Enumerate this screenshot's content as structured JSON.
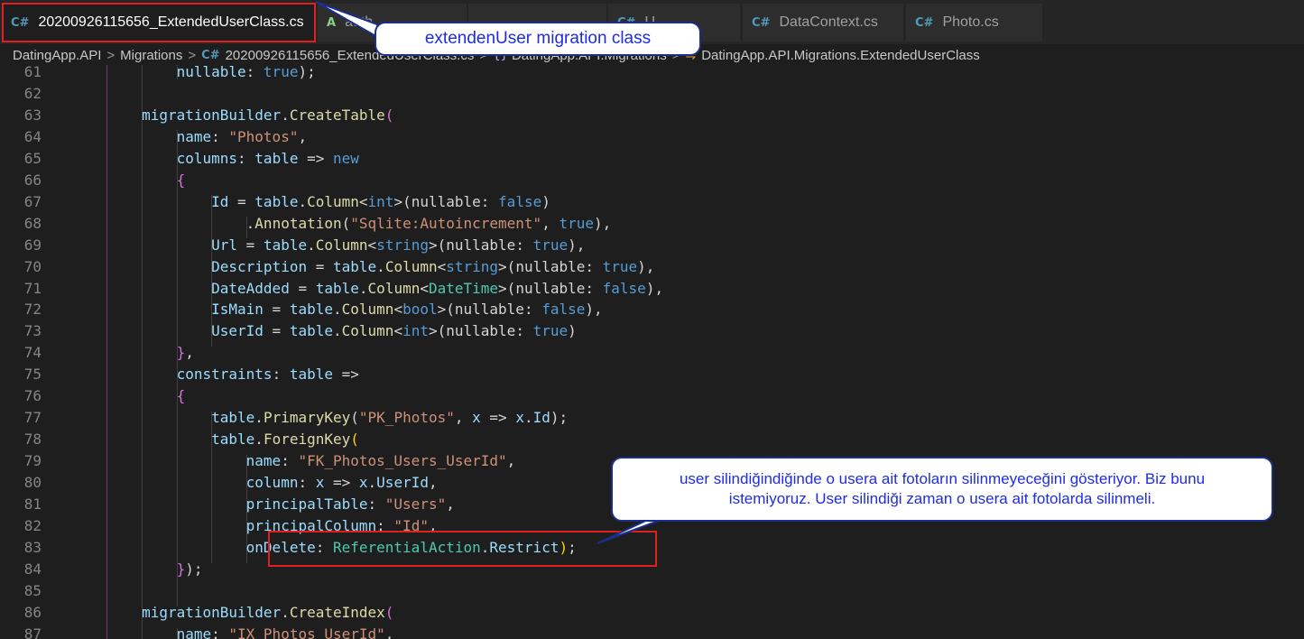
{
  "tabs": [
    {
      "icon": "C#",
      "label": "20200926115656_ExtendedUserClass.cs",
      "active": true,
      "close": "✕"
    },
    {
      "icon": "A",
      "label": "auth"
    },
    {
      "icon": "",
      "label": ""
    },
    {
      "icon": "C#",
      "label": "U"
    },
    {
      "icon": "C#",
      "label": "DataContext.cs"
    },
    {
      "icon": "C#",
      "label": "Photo.cs"
    }
  ],
  "breadcrumb": {
    "items": [
      "DatingApp.API",
      "Migrations",
      "20200926115656_ExtendedUserClass.cs",
      "DatingApp.API.Migrations",
      "DatingApp.API.Migrations.ExtendedUserClass"
    ],
    "separator": ">",
    "cs_icon": "C#",
    "ns_icon": "{}",
    "class_icon": "⇋"
  },
  "code_lines": [
    {
      "num": "61",
      "tokens": [
        [
          "i",
          "            "
        ],
        [
          "var",
          "nullable"
        ],
        [
          "p",
          ": "
        ],
        [
          "kw",
          "true"
        ],
        [
          "p",
          ");"
        ]
      ]
    },
    {
      "num": "62",
      "tokens": []
    },
    {
      "num": "63",
      "tokens": [
        [
          "i",
          "        "
        ],
        [
          "var",
          "migrationBuilder"
        ],
        [
          "p",
          "."
        ],
        [
          "fn",
          "CreateTable"
        ],
        [
          "br",
          "("
        ]
      ]
    },
    {
      "num": "64",
      "tokens": [
        [
          "i",
          "            "
        ],
        [
          "var",
          "name"
        ],
        [
          "p",
          ": "
        ],
        [
          "str",
          "\"Photos\""
        ],
        [
          "p",
          ","
        ]
      ]
    },
    {
      "num": "65",
      "tokens": [
        [
          "i",
          "            "
        ],
        [
          "var",
          "columns"
        ],
        [
          "p",
          ": "
        ],
        [
          "var",
          "table"
        ],
        [
          "p",
          " => "
        ],
        [
          "kw",
          "new"
        ]
      ]
    },
    {
      "num": "66",
      "tokens": [
        [
          "i",
          "            "
        ],
        [
          "br",
          "{"
        ]
      ]
    },
    {
      "num": "67",
      "tokens": [
        [
          "i",
          "                "
        ],
        [
          "var",
          "Id"
        ],
        [
          "p",
          " = "
        ],
        [
          "var",
          "table"
        ],
        [
          "p",
          "."
        ],
        [
          "fn",
          "Column"
        ],
        [
          "p",
          "<"
        ],
        [
          "kw",
          "int"
        ],
        [
          "p",
          ">(nullable: "
        ],
        [
          "kw",
          "false"
        ],
        [
          "p",
          ")"
        ]
      ]
    },
    {
      "num": "68",
      "tokens": [
        [
          "i",
          "                    "
        ],
        [
          "p",
          "."
        ],
        [
          "fn",
          "Annotation"
        ],
        [
          "p",
          "("
        ],
        [
          "str",
          "\"Sqlite:Autoincrement\""
        ],
        [
          "p",
          ", "
        ],
        [
          "kw",
          "true"
        ],
        [
          "p",
          "),"
        ]
      ]
    },
    {
      "num": "69",
      "tokens": [
        [
          "i",
          "                "
        ],
        [
          "var",
          "Url"
        ],
        [
          "p",
          " = "
        ],
        [
          "var",
          "table"
        ],
        [
          "p",
          "."
        ],
        [
          "fn",
          "Column"
        ],
        [
          "p",
          "<"
        ],
        [
          "kw",
          "string"
        ],
        [
          "p",
          ">(nullable: "
        ],
        [
          "kw",
          "true"
        ],
        [
          "p",
          "),"
        ]
      ]
    },
    {
      "num": "70",
      "tokens": [
        [
          "i",
          "                "
        ],
        [
          "var",
          "Description"
        ],
        [
          "p",
          " = "
        ],
        [
          "var",
          "table"
        ],
        [
          "p",
          "."
        ],
        [
          "fn",
          "Column"
        ],
        [
          "p",
          "<"
        ],
        [
          "kw",
          "string"
        ],
        [
          "p",
          ">(nullable: "
        ],
        [
          "kw",
          "true"
        ],
        [
          "p",
          "),"
        ]
      ]
    },
    {
      "num": "71",
      "tokens": [
        [
          "i",
          "                "
        ],
        [
          "var",
          "DateAdded"
        ],
        [
          "p",
          " = "
        ],
        [
          "var",
          "table"
        ],
        [
          "p",
          "."
        ],
        [
          "fn",
          "Column"
        ],
        [
          "p",
          "<"
        ],
        [
          "ty",
          "DateTime"
        ],
        [
          "p",
          ">(nullable: "
        ],
        [
          "kw",
          "false"
        ],
        [
          "p",
          "),"
        ]
      ]
    },
    {
      "num": "72",
      "tokens": [
        [
          "i",
          "                "
        ],
        [
          "var",
          "IsMain"
        ],
        [
          "p",
          " = "
        ],
        [
          "var",
          "table"
        ],
        [
          "p",
          "."
        ],
        [
          "fn",
          "Column"
        ],
        [
          "p",
          "<"
        ],
        [
          "kw",
          "bool"
        ],
        [
          "p",
          ">(nullable: "
        ],
        [
          "kw",
          "false"
        ],
        [
          "p",
          "),"
        ]
      ]
    },
    {
      "num": "73",
      "tokens": [
        [
          "i",
          "                "
        ],
        [
          "var",
          "UserId"
        ],
        [
          "p",
          " = "
        ],
        [
          "var",
          "table"
        ],
        [
          "p",
          "."
        ],
        [
          "fn",
          "Column"
        ],
        [
          "p",
          "<"
        ],
        [
          "kw",
          "int"
        ],
        [
          "p",
          ">(nullable: "
        ],
        [
          "kw",
          "true"
        ],
        [
          "p",
          ")"
        ]
      ]
    },
    {
      "num": "74",
      "tokens": [
        [
          "i",
          "            "
        ],
        [
          "br",
          "}"
        ],
        [
          "p",
          ","
        ]
      ]
    },
    {
      "num": "75",
      "tokens": [
        [
          "i",
          "            "
        ],
        [
          "var",
          "constraints"
        ],
        [
          "p",
          ": "
        ],
        [
          "var",
          "table"
        ],
        [
          "p",
          " =>"
        ]
      ]
    },
    {
      "num": "76",
      "tokens": [
        [
          "i",
          "            "
        ],
        [
          "br",
          "{"
        ]
      ]
    },
    {
      "num": "77",
      "tokens": [
        [
          "i",
          "                "
        ],
        [
          "var",
          "table"
        ],
        [
          "p",
          "."
        ],
        [
          "fn",
          "PrimaryKey"
        ],
        [
          "p",
          "("
        ],
        [
          "str",
          "\"PK_Photos\""
        ],
        [
          "p",
          ", "
        ],
        [
          "var",
          "x"
        ],
        [
          "p",
          " => "
        ],
        [
          "var",
          "x"
        ],
        [
          "p",
          "."
        ],
        [
          "var",
          "Id"
        ],
        [
          "p",
          ");"
        ]
      ]
    },
    {
      "num": "78",
      "tokens": [
        [
          "i",
          "                "
        ],
        [
          "var",
          "table"
        ],
        [
          "p",
          "."
        ],
        [
          "fn",
          "ForeignKey"
        ],
        [
          "br2",
          "("
        ]
      ]
    },
    {
      "num": "79",
      "tokens": [
        [
          "i",
          "                    "
        ],
        [
          "var",
          "name"
        ],
        [
          "p",
          ": "
        ],
        [
          "str",
          "\"FK_Photos_Users_UserId\""
        ],
        [
          "p",
          ","
        ]
      ]
    },
    {
      "num": "80",
      "tokens": [
        [
          "i",
          "                    "
        ],
        [
          "var",
          "column"
        ],
        [
          "p",
          ": "
        ],
        [
          "var",
          "x"
        ],
        [
          "p",
          " => "
        ],
        [
          "var",
          "x"
        ],
        [
          "p",
          "."
        ],
        [
          "var",
          "UserId"
        ],
        [
          "p",
          ","
        ]
      ]
    },
    {
      "num": "81",
      "tokens": [
        [
          "i",
          "                    "
        ],
        [
          "var",
          "principalTable"
        ],
        [
          "p",
          ": "
        ],
        [
          "str",
          "\"Users\""
        ],
        [
          "p",
          ","
        ]
      ]
    },
    {
      "num": "82",
      "tokens": [
        [
          "i",
          "                    "
        ],
        [
          "var",
          "principalColumn"
        ],
        [
          "p",
          ": "
        ],
        [
          "str",
          "\"Id\""
        ],
        [
          "p",
          ","
        ]
      ]
    },
    {
      "num": "83",
      "tokens": [
        [
          "i",
          "                    "
        ],
        [
          "var",
          "onDelete"
        ],
        [
          "p",
          ": "
        ],
        [
          "ty",
          "ReferentialAction"
        ],
        [
          "p",
          "."
        ],
        [
          "var",
          "Restrict"
        ],
        [
          "br2",
          ")"
        ],
        [
          "p",
          ";"
        ]
      ]
    },
    {
      "num": "84",
      "tokens": [
        [
          "i",
          "            "
        ],
        [
          "br",
          "}"
        ],
        [
          "p",
          ");"
        ]
      ]
    },
    {
      "num": "85",
      "tokens": []
    },
    {
      "num": "86",
      "tokens": [
        [
          "i",
          "        "
        ],
        [
          "var",
          "migrationBuilder"
        ],
        [
          "p",
          "."
        ],
        [
          "fn",
          "CreateIndex"
        ],
        [
          "br",
          "("
        ]
      ]
    },
    {
      "num": "87",
      "tokens": [
        [
          "i",
          "            "
        ],
        [
          "var",
          "name"
        ],
        [
          "p",
          ": "
        ],
        [
          "str",
          "\"IX_Photos_UserId\""
        ],
        [
          "p",
          ","
        ]
      ]
    }
  ],
  "annotations": {
    "top_callout": "extendenUser migration class",
    "bottom_callout": "user silindiğindiğinde o usera ait fotoların silinmeyeceğini gösteriyor. Biz bunu istemiyoruz. User silindiği zaman o usera ait fotolarda silinmeli."
  },
  "colors": {
    "annotation_text": "#1f2de0",
    "highlight_box": "#e01f1f",
    "callout_border": "#1b2f8a"
  }
}
